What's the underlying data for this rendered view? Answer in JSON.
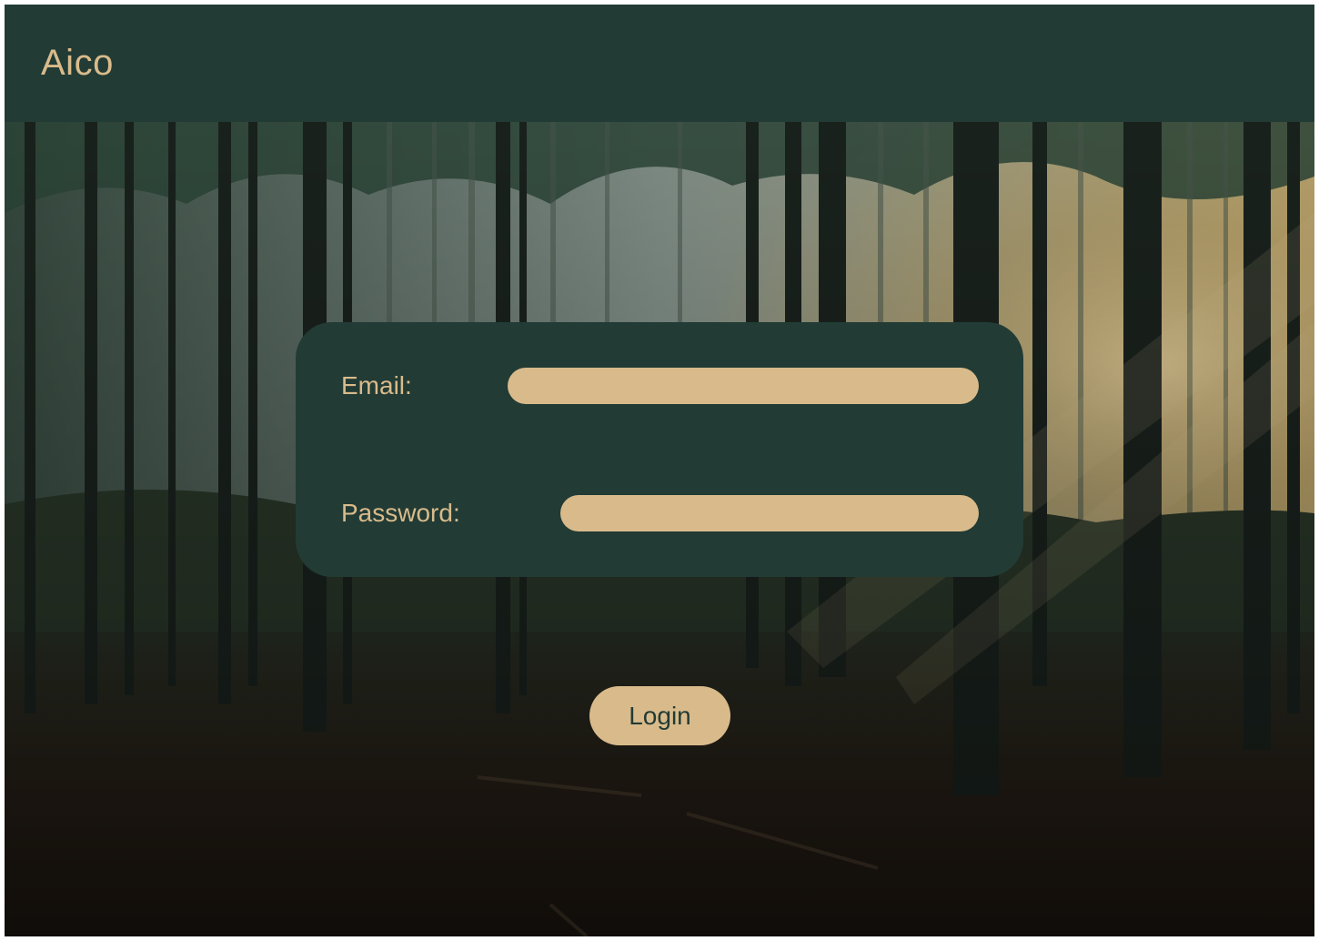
{
  "app": {
    "brand": "Aico"
  },
  "form": {
    "email_label": "Email:",
    "email_value": "",
    "password_label": "Password:",
    "password_value": "",
    "login_label": "Login"
  },
  "colors": {
    "dark_green": "#223b35",
    "sand": "#d9bb8b"
  },
  "background": {
    "description_icon": "forest-background-image"
  }
}
